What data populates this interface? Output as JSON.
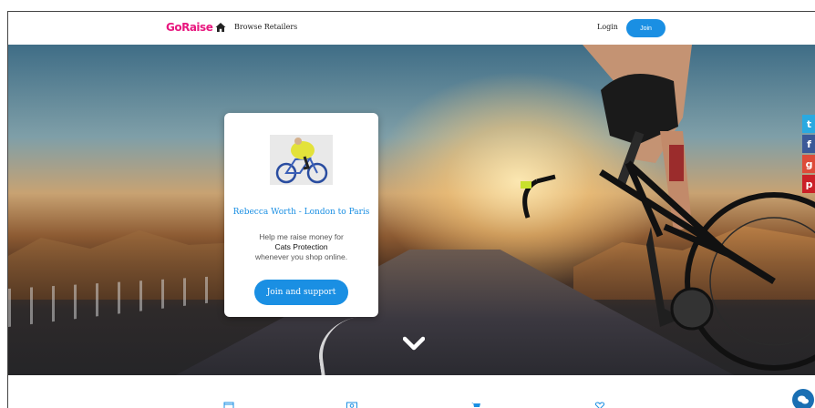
{
  "nav": {
    "logo": "GoRaise",
    "home_icon": "home-icon",
    "browse_label": "Browse Retailers",
    "login_label": "Login",
    "join_label": "Join"
  },
  "hero": {
    "chevron_icon": "chevron-down-icon"
  },
  "card": {
    "title": "Rebecca Worth - London to Paris",
    "help_text": "Help me raise money for",
    "charity": "Cats Protection",
    "when_text": "whenever you shop online.",
    "button_label": "Join and support"
  },
  "social": {
    "twitter": "twitter-icon",
    "facebook": "facebook-icon",
    "googleplus": "google-plus-icon",
    "pinterest": "pinterest-icon"
  },
  "features": {
    "icons": [
      "calendar-icon",
      "money-icon",
      "cart-icon",
      "heart-icon"
    ]
  },
  "chat": {
    "icon": "chat-icon"
  },
  "colors": {
    "brand_pink": "#e8187f",
    "accent_blue": "#1a8fe3"
  }
}
